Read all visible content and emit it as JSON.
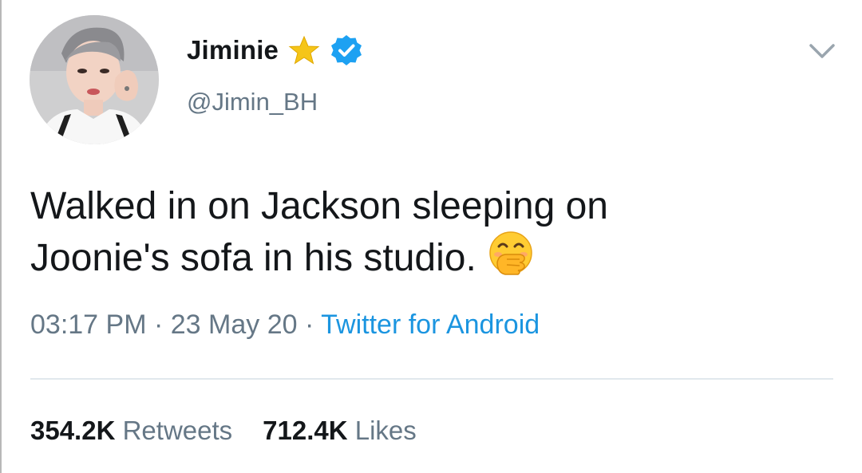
{
  "author": {
    "display_name": "Jiminie",
    "handle": "@Jimin_BH",
    "badges": [
      "star-icon",
      "verified-icon"
    ],
    "avatar": "profile photo"
  },
  "tweet": {
    "text_line1": "Walked in on Jackson sleeping on",
    "text_line2": "Joonie's sofa in his studio.",
    "emoji": "face-with-hand-over-mouth-icon",
    "time": "03:17 PM",
    "separator": "·",
    "date": "23 May 20",
    "source": "Twitter for Android"
  },
  "stats": {
    "retweets_count": "354.2K",
    "retweets_label": "Retweets",
    "likes_count": "712.4K",
    "likes_label": "Likes"
  },
  "colors": {
    "text": "#14171a",
    "secondary": "#657786",
    "link": "#1b95e0",
    "verified": "#1da1f2",
    "star": "#f5c518",
    "divider": "#e1e8ed"
  }
}
